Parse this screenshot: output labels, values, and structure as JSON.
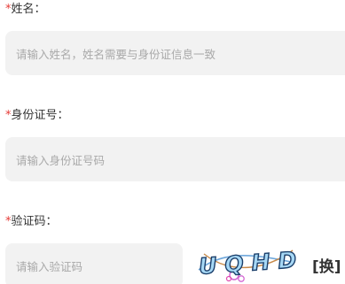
{
  "form": {
    "name": {
      "required_mark": "*",
      "label": "姓名：",
      "placeholder": "请输入姓名，姓名需要与身份证信息一致"
    },
    "id_number": {
      "required_mark": "*",
      "label": "身份证号：",
      "placeholder": "请输入身份证号码"
    },
    "captcha": {
      "required_mark": "*",
      "label": "验证码：",
      "placeholder": "请输入验证码",
      "captcha_text": "UQHD",
      "refresh_label": "[换]"
    }
  },
  "colors": {
    "required": "#e53935",
    "field_bg": "#f2f2f2",
    "placeholder": "#a9a9a9",
    "label": "#333333"
  }
}
